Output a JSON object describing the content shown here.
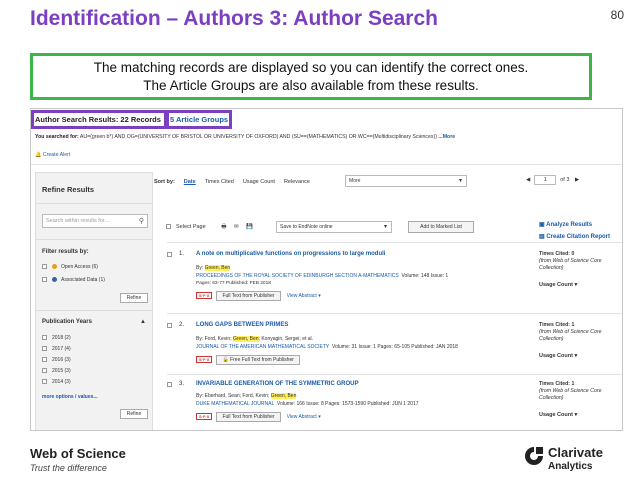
{
  "slide": {
    "title": "Identification – Authors 3: Author Search",
    "page_number": "80",
    "callout_line1": "The matching records are displayed so you can identify the correct ones.",
    "callout_line2": "The Article Groups are also available from these results.",
    "accent_purple": "#7b3fbf",
    "accent_green": "#3cb54a"
  },
  "screenshot": {
    "results_header": "Author Search Results: 22 Records",
    "article_groups_link": "5 Article Groups",
    "searched_label": "You searched for:",
    "searched_query": "AU=(green b*) AND OG=(UNIVERSITY OF BRISTOL OR UNIVERSITY OF OXFORD) AND (SU==(MATHEMATICS) OR WC==(Multidisciplinary Sciences))",
    "searched_more": "...More",
    "create_alert": "Create Alert",
    "sidebar": {
      "title": "Refine Results",
      "search_placeholder": "Search within results for...",
      "filter_heading": "Filter results by:",
      "filters": [
        "Open Access (6)",
        "Associated Data (1)"
      ],
      "refine_label": "Refine",
      "pub_years_heading": "Publication Years",
      "years": [
        "2018 (2)",
        "2017 (4)",
        "2016 (3)",
        "2015 (3)",
        "2014 (3)"
      ],
      "more_options": "more options / values..."
    },
    "sort": {
      "label": "Sort by:",
      "options": [
        "Date",
        "Times Cited",
        "Usage Count",
        "Relevance"
      ],
      "more_select": "More",
      "page_current": "1",
      "page_of": "of 3"
    },
    "toolbar": {
      "select_page": "Select Page",
      "save_to": "Save to EndNote online",
      "add_marked": "Add to Marked List",
      "analyze": "Analyze Results",
      "citation_report": "Create Citation Report"
    },
    "records": [
      {
        "num": "1.",
        "title": "A note on multiplicative functions on progressions to large moduli",
        "by_prefix": "By: ",
        "by_pre": "",
        "by_hl": "Green, Ben",
        "by_post": "",
        "source": "PROCEEDINGS OF THE ROYAL SOCIETY OF EDINBURGH SECTION A-MATHEMATICS",
        "details": "Volume: 148  Issue: 1",
        "pages": "Pages: 63-77  Published: FEB 2018",
        "action": "Full Text from Publisher",
        "view_abstract": "View Abstract ▾",
        "times_cited": "Times Cited: 0",
        "cited_source": "(from Web of Science Core Collection)",
        "usage": "Usage Count ▾"
      },
      {
        "num": "2.",
        "title": "LONG GAPS BETWEEN PRIMES",
        "by_prefix": "By: ",
        "by_pre": "Ford, Kevin; ",
        "by_hl": "Green, Ben",
        "by_post": "; Konyagin, Sergei; et al.",
        "source": "JOURNAL OF THE AMERICAN MATHEMATICAL SOCIETY",
        "details": "Volume: 31  Issue: 1  Pages: 65-105  Published: JAN 2018",
        "pages": "",
        "action": "Free Full Text from Publisher",
        "view_abstract": "",
        "times_cited": "Times Cited: 1",
        "cited_source": "(from Web of Science Core Collection)",
        "usage": "Usage Count ▾"
      },
      {
        "num": "3.",
        "title": "INVARIABLE GENERATION OF THE SYMMETRIC GROUP",
        "by_prefix": "By: ",
        "by_pre": "Eberhard, Sean; Ford, Kevin; ",
        "by_hl": "Green, Ben",
        "by_post": "",
        "source": "DUKE MATHEMATICAL JOURNAL",
        "details": "Volume: 166  Issue: 8  Pages: 1573-1590  Published: JUN 1 2017",
        "pages": "",
        "action": "Full Text from Publisher",
        "view_abstract": "View Abstract ▾",
        "times_cited": "Times Cited: 1",
        "cited_source": "(from Web of Science Core Collection)",
        "usage": "Usage Count ▾"
      }
    ]
  },
  "footer": {
    "wos": "Web of Science",
    "wos_tagline": "Trust the difference",
    "clarivate": "Clarivate",
    "analytics": "Analytics"
  }
}
